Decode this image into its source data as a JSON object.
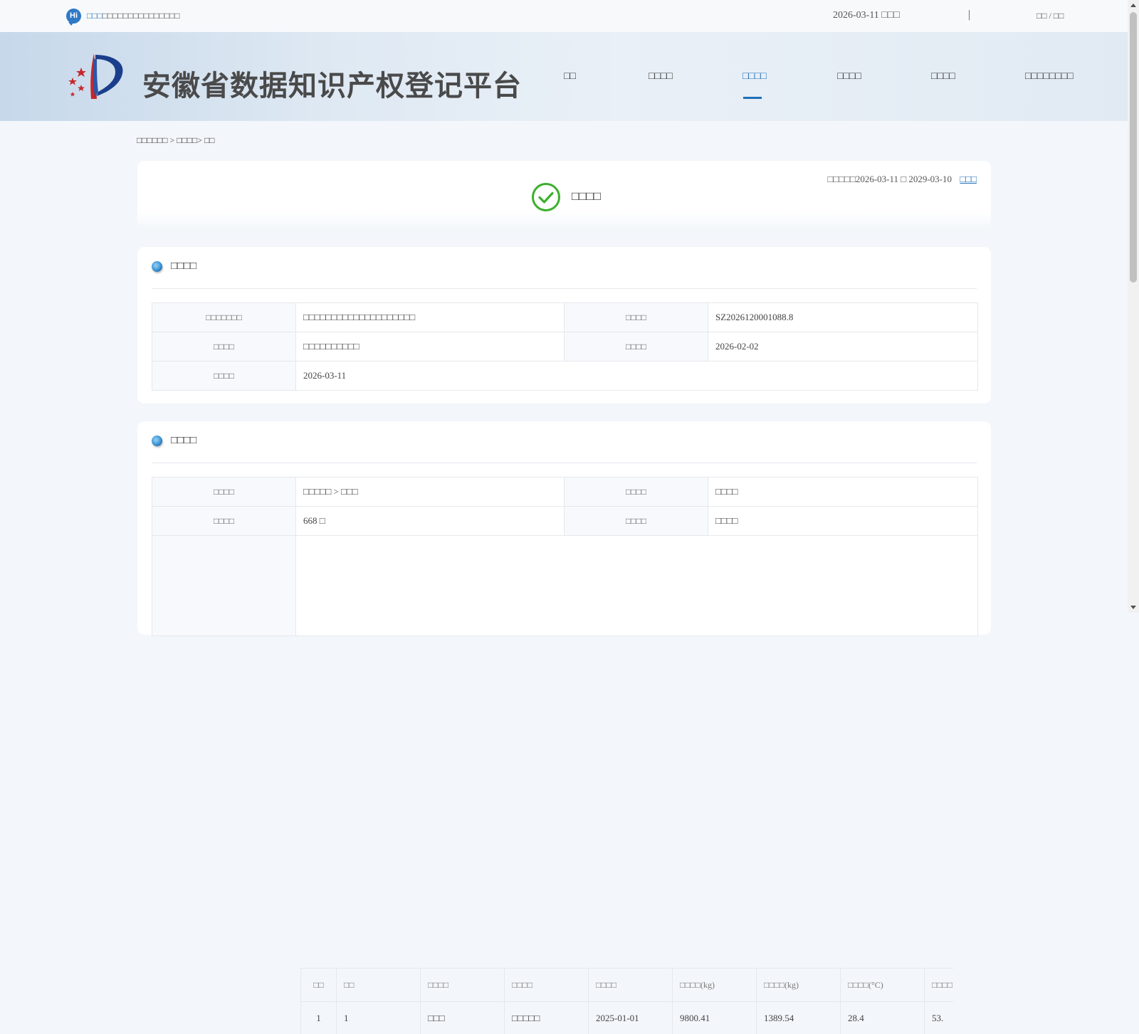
{
  "topbar": {
    "hi_badge": "Hi",
    "greeting_user": "□□□",
    "greeting_text": "□□□□□□□□□□□□□□□",
    "date": "2026-03-11 □□□",
    "separator": "|",
    "auth_link": "□□ / □□"
  },
  "header": {
    "site_title": "安徽省数据知识产权登记平台",
    "nav": [
      {
        "label": "□□",
        "active": false
      },
      {
        "label": "□□□□",
        "active": false
      },
      {
        "label": "□□□□",
        "active": true
      },
      {
        "label": "□□□□",
        "active": false
      },
      {
        "label": "□□□□",
        "active": false
      },
      {
        "label": "□□□□□□□□",
        "active": false
      }
    ]
  },
  "breadcrumb": "□□□□□□ > □□□□> □□",
  "status": {
    "text": "□□□□",
    "validity_prefix": "□□□□□",
    "validity_range": "2026-03-11 □ 2029-03-10",
    "cert_link": "□□□",
    "icon": "check-circle-icon",
    "icon_color": "#3bb02b"
  },
  "section1": {
    "title": "□□□□",
    "rows": [
      {
        "k1": "□□□□□□□",
        "v1": "□□□□□□□□□□□□□□□□□□□□",
        "k2": "□□□□",
        "v2": "SZ2026120001088.8"
      },
      {
        "k1": "□□□□",
        "v1": "□□□□□□□□□□",
        "k2": "□□□□",
        "v2": "2026-02-02"
      },
      {
        "k1": "□□□□",
        "v1": "2026-03-11"
      }
    ]
  },
  "section2": {
    "title": "□□□□",
    "rows": [
      {
        "k1": "□□□□",
        "v1": "□□□□□ > □□□",
        "k2": "□□□□",
        "v2": "□□□□"
      },
      {
        "k1": "□□□□",
        "v1": "668 □",
        "k2": "□□□□",
        "v2": "□□□□"
      }
    ],
    "sample_table": {
      "headers": [
        "□□",
        "□□",
        "□□□□",
        "□□□□",
        "□□□□",
        "□□□□(kg)",
        "□□□□(kg)",
        "□□□□(°C)",
        "□□□□"
      ],
      "rows": [
        [
          "1",
          "1",
          "□□□",
          "□□□□□",
          "2025-01-01",
          "9800.41",
          "1389.54",
          "28.4",
          "53."
        ]
      ]
    }
  },
  "colors": {
    "accent": "#1f6fb8",
    "success": "#3bb02b"
  }
}
